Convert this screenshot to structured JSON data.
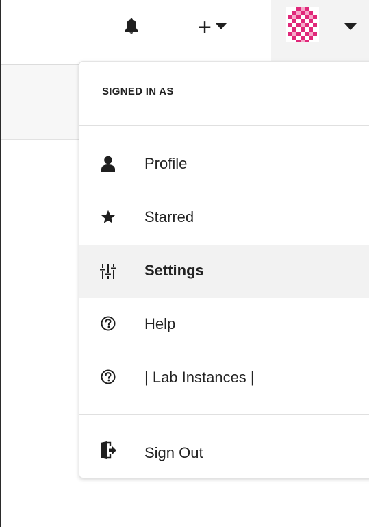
{
  "topbar": {
    "notifications_icon": "bell-icon",
    "new_icon": "plus-icon",
    "new_glyph": "+",
    "user_menu_caret_icon": "caret-down-icon"
  },
  "user_menu": {
    "header": "SIGNED IN AS",
    "items": [
      {
        "label": "Profile",
        "icon": "user-icon"
      },
      {
        "label": "Starred",
        "icon": "star-icon"
      },
      {
        "label": "Settings",
        "icon": "sliders-icon",
        "active": true
      },
      {
        "label": "Help",
        "icon": "question-circle-icon"
      },
      {
        "label": "| Lab Instances |",
        "icon": "question-circle-icon"
      }
    ],
    "signout": {
      "label": "Sign Out",
      "icon": "sign-out-icon"
    }
  },
  "colors": {
    "avatar_pink": "#e0287a",
    "avatar_bg": "#fbe1ec",
    "active_row_bg": "#f2f2f2",
    "user_button_bg": "#f3f3f3",
    "text": "#232323"
  }
}
